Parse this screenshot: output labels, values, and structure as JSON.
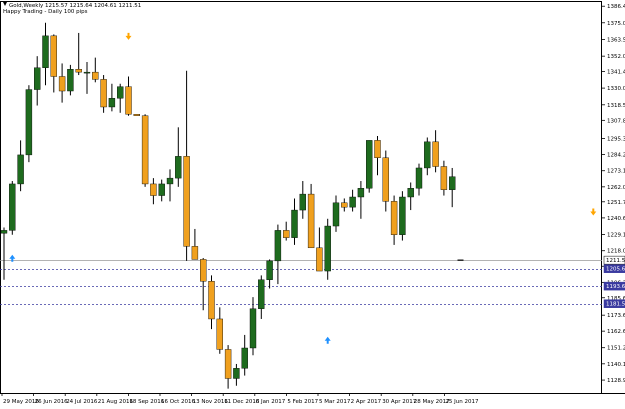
{
  "header": {
    "symbol_line": "Gold,Weekly  1215.57 1215.64 1204.61 1211.51",
    "indicator_label": "Happy Trading - Daily 100 pips"
  },
  "colors": {
    "background": "#ffffff",
    "frame": "#000000",
    "bull_candle": "#1e6b1e",
    "bear_candle": "#f0a01e",
    "wick": "#000000",
    "signal_buy": "#1e90ff",
    "signal_sell": "#ffa500",
    "level_line": "#3a3aa0",
    "current_price_line": "#9a9a9a",
    "label_bg": "#3a3aa0",
    "label_text": "#ffffff"
  },
  "chart_data": {
    "type": "candlestick",
    "symbol": "Gold",
    "timeframe": "Weekly",
    "ohlc_header": {
      "open": 1215.57,
      "high": 1215.64,
      "low": 1204.61,
      "close": 1211.51
    },
    "price_axis": {
      "range": [
        1120.0,
        1390.0
      ],
      "ticks": [
        "1386.40",
        "1375.00",
        "1363.50",
        "1352.00",
        "1341.40",
        "1330.00",
        "1318.50",
        "1307.80",
        "1295.30",
        "1284.20",
        "1273.10",
        "1262.00",
        "1251.70",
        "1240.60",
        "1229.10",
        "1218.00",
        "1207.30",
        "1196.20",
        "1185.60",
        "1173.60",
        "1162.60",
        "1151.20",
        "1140.10",
        "1128.90"
      ]
    },
    "time_axis": {
      "labels": [
        "29 May 2016",
        "26 Jun 2016",
        "24 Jul 2016",
        "21 Aug 2016",
        "18 Sep 2016",
        "16 Oct 2016",
        "13 Nov 2016",
        "11 Dec 2016",
        "8 Jan 2017",
        "5 Feb 2017",
        "5 Mar 2017",
        "2 Apr 2017",
        "30 Apr 2017",
        "28 May 2017",
        "25 Jun 2017"
      ]
    },
    "price_labels": [
      {
        "text": "1211.51",
        "value": 1211.51,
        "style": "current"
      },
      {
        "text": "1205.62",
        "value": 1205.62,
        "style": "level"
      },
      {
        "text": "1193.61",
        "value": 1193.61,
        "style": "level"
      },
      {
        "text": "1181.50",
        "value": 1181.5,
        "style": "level"
      }
    ],
    "horizontal_lines": [
      {
        "value": 1211.51,
        "style": "solid"
      },
      {
        "value": 1205.62,
        "style": "dashed"
      },
      {
        "value": 1193.61,
        "style": "dashed"
      },
      {
        "value": 1181.5,
        "style": "dashed"
      }
    ],
    "signals": [
      {
        "index": 1,
        "type": "buy",
        "value": 1212.5
      },
      {
        "index": 15,
        "type": "sell",
        "value": 1366.0
      },
      {
        "index": 39,
        "type": "buy",
        "value": 1156.0
      },
      {
        "index": 71,
        "type": "sell",
        "value": 1245.0
      }
    ],
    "candles": [
      [
        1230,
        1234,
        1198,
        1232
      ],
      [
        1232,
        1266,
        1229,
        1264
      ],
      [
        1264,
        1294,
        1259,
        1284
      ],
      [
        1284,
        1332,
        1279,
        1329
      ],
      [
        1329,
        1352,
        1318,
        1344
      ],
      [
        1344,
        1375,
        1332,
        1366
      ],
      [
        1366,
        1367,
        1327,
        1338
      ],
      [
        1338,
        1347,
        1320,
        1328
      ],
      [
        1328,
        1346,
        1325,
        1343
      ],
      [
        1343,
        1368,
        1339,
        1341
      ],
      [
        1341,
        1348,
        1326,
        1341
      ],
      [
        1341,
        1351,
        1334,
        1336
      ],
      [
        1336,
        1339,
        1313,
        1317
      ],
      [
        1317,
        1333,
        1314,
        1323
      ],
      [
        1323,
        1333,
        1313,
        1331
      ],
      [
        1331,
        1338,
        1311,
        1312
      ],
      [
        1312,
        1311,
        1311,
        1311
      ],
      [
        1311,
        1312,
        1262,
        1264
      ],
      [
        1264,
        1268,
        1250,
        1256
      ],
      [
        1256,
        1267,
        1252,
        1264
      ],
      [
        1264,
        1274,
        1252,
        1268
      ],
      [
        1268,
        1303,
        1262,
        1283
      ],
      [
        1283,
        1342,
        1211,
        1221
      ],
      [
        1221,
        1233,
        1212,
        1212
      ],
      [
        1212,
        1213,
        1177,
        1197
      ],
      [
        1197,
        1201,
        1164,
        1171
      ],
      [
        1171,
        1179,
        1147,
        1150
      ],
      [
        1150,
        1153,
        1123,
        1130
      ],
      [
        1130,
        1140,
        1125,
        1137
      ],
      [
        1137,
        1160,
        1132,
        1151
      ],
      [
        1151,
        1186,
        1146,
        1178
      ],
      [
        1178,
        1201,
        1171,
        1198
      ],
      [
        1198,
        1212,
        1192,
        1211
      ],
      [
        1211,
        1236,
        1195,
        1232
      ],
      [
        1232,
        1238,
        1225,
        1227
      ],
      [
        1227,
        1254,
        1222,
        1246
      ],
      [
        1246,
        1266,
        1240,
        1257
      ],
      [
        1257,
        1264,
        1220,
        1220
      ],
      [
        1220,
        1234,
        1204,
        1204
      ],
      [
        1204,
        1240,
        1198,
        1235
      ],
      [
        1235,
        1256,
        1231,
        1251
      ],
      [
        1251,
        1254,
        1245,
        1248
      ],
      [
        1248,
        1260,
        1245,
        1255
      ],
      [
        1255,
        1266,
        1240,
        1261
      ],
      [
        1261,
        1294,
        1258,
        1294
      ],
      [
        1294,
        1297,
        1270,
        1282
      ],
      [
        1282,
        1287,
        1245,
        1252
      ],
      [
        1252,
        1256,
        1222,
        1229
      ],
      [
        1229,
        1259,
        1225,
        1255
      ],
      [
        1255,
        1265,
        1246,
        1261
      ],
      [
        1261,
        1278,
        1256,
        1275
      ],
      [
        1275,
        1296,
        1270,
        1293
      ],
      [
        1293,
        1301,
        1272,
        1276
      ],
      [
        1276,
        1280,
        1256,
        1260
      ],
      [
        1260,
        1275,
        1248,
        1269
      ]
    ]
  }
}
